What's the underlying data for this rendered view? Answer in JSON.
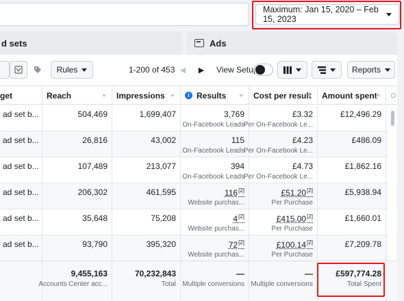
{
  "date_range": {
    "label": "Maximum: Jan 15, 2020 – Feb 15, 2023"
  },
  "tabs": {
    "ad_sets": "d sets",
    "ads": "Ads"
  },
  "toolbar": {
    "rules_label": "Rules",
    "pagination": "1-200 of 453",
    "view_setup": "View Setup",
    "reports_label": "Reports"
  },
  "columns": {
    "name": "get",
    "reach": "Reach",
    "impressions": "Impressions",
    "results": "Results",
    "cpr": "Cost per result",
    "amount": "Amount spent"
  },
  "rows": [
    {
      "name": "g ad set b...",
      "reach": "504,469",
      "impressions": "1,699,407",
      "results": "3,769",
      "results_sub": "On-Facebook Leads",
      "cpr": "£3.32",
      "cpr_sub": "Per On-Facebook Le...",
      "amount": "£12,496.29"
    },
    {
      "name": "g ad set b...",
      "reach": "26,816",
      "impressions": "43,002",
      "results": "115",
      "results_sub": "On-Facebook Leads",
      "cpr": "£4.23",
      "cpr_sub": "Per On-Facebook Le...",
      "amount": "£486.09"
    },
    {
      "name": "g ad set b...",
      "reach": "107,489",
      "impressions": "213,077",
      "results": "394",
      "results_sub": "On-Facebook Leads",
      "cpr": "£4.73",
      "cpr_sub": "Per On-Facebook Le...",
      "amount": "£1,862.16"
    },
    {
      "name": "g ad set b...",
      "reach": "206,302",
      "impressions": "461,595",
      "results": "116",
      "results_sup": "[2]",
      "results_sub": "Website purchas...",
      "cpr": "£51.20",
      "cpr_sup": "[2]",
      "cpr_sub": "Per Purchase",
      "amount": "£5,938.94"
    },
    {
      "name": "g ad set b...",
      "reach": "35,648",
      "impressions": "75,208",
      "results": "4",
      "results_sup": "[2]",
      "results_sub": "Website purchas...",
      "cpr": "£415.00",
      "cpr_sup": "[2]",
      "cpr_sub": "Per Purchase",
      "amount": "£1,660.01"
    },
    {
      "name": "g ad set b...",
      "reach": "93,790",
      "impressions": "395,320",
      "results": "72",
      "results_sup": "[2]",
      "results_sub": "Website purchas...",
      "cpr": "£100.14",
      "cpr_sup": "[2]",
      "cpr_sub": "Per Purchase",
      "amount": "£7,209.78"
    }
  ],
  "totals": {
    "reach": "9,455,163",
    "reach_sub": "Accounts Center acc...",
    "impressions": "70,232,843",
    "impressions_sub": "Total",
    "results": "—",
    "results_sub": "Multiple conversions",
    "cpr": "—",
    "cpr_sub": "Multiple conversions",
    "amount": "£597,774.28",
    "amount_sub": "Total Spent"
  },
  "colors": {
    "accent": "#1877f2",
    "highlight": "#e5161a"
  }
}
